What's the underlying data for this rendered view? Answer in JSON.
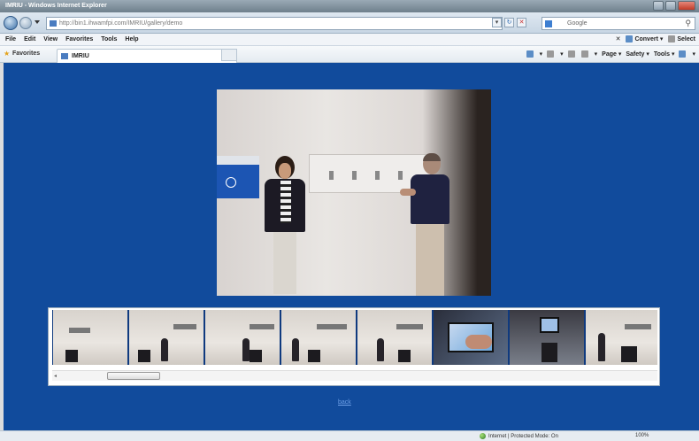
{
  "window": {
    "title": "IMRIU - Windows Internet Explorer"
  },
  "address": {
    "url": "http://bin1.ihwamfpi.com/IMRIU/gallery/demo",
    "search_engine": "Google"
  },
  "menu": {
    "items": [
      "File",
      "Edit",
      "View",
      "Favorites",
      "Tools",
      "Help"
    ],
    "right": [
      "Convert",
      "Select"
    ]
  },
  "favorites": {
    "label": "Favorites",
    "tab_title": "IMRIU"
  },
  "commandbar": {
    "items": [
      "Page",
      "Safety",
      "Tools"
    ]
  },
  "main": {
    "back_link": "back"
  },
  "status": {
    "mode": "Internet | Protected Mode: On",
    "zoom": "100%"
  },
  "colors": {
    "page_background": "#114b9c",
    "titlebar": "#6e7f8c"
  },
  "icons": {
    "back": "back-arrow-icon",
    "forward": "forward-arrow-icon",
    "refresh": "refresh-icon",
    "stop": "stop-icon",
    "search": "search-icon",
    "favorites": "star-icon"
  }
}
